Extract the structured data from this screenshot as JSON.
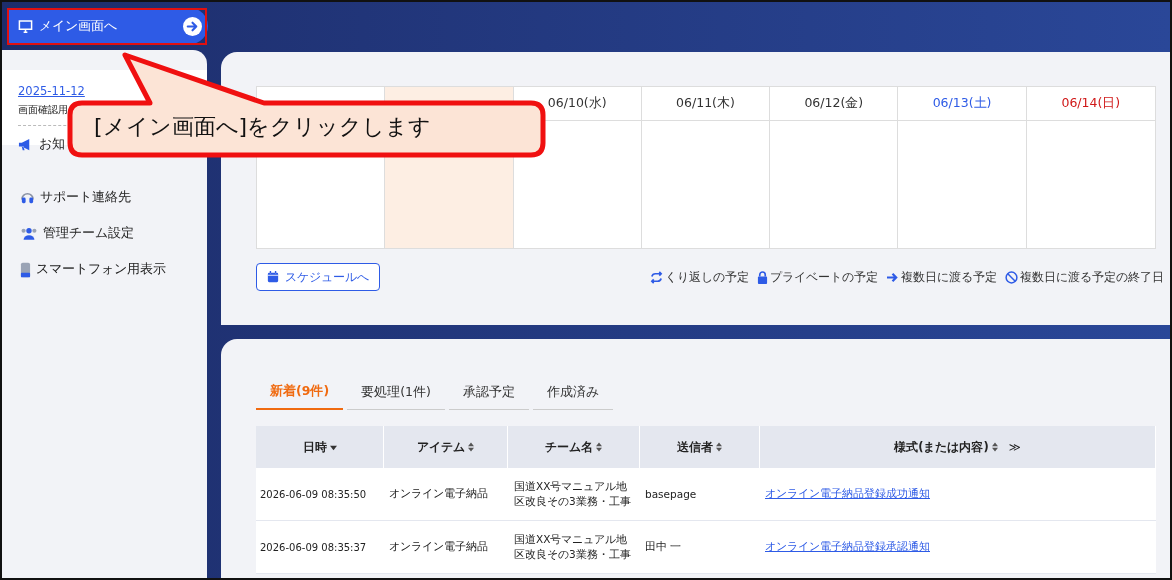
{
  "top_bar": {
    "main_button": "メイン画面へ"
  },
  "sidebar": {
    "date_link": "2025-11-12",
    "note": "画面確認用",
    "notice": "お知",
    "items": [
      {
        "label": "サポート連絡先"
      },
      {
        "label": "管理チーム設定"
      },
      {
        "label": "スマートフォン用表示"
      }
    ]
  },
  "calendar": {
    "days": [
      {
        "kind": "weekday",
        "today": false
      },
      {
        "kind": "weekday",
        "today": true
      },
      {
        "label": "06/10(水)",
        "kind": "weekday",
        "today": false
      },
      {
        "label": "06/11(木)",
        "kind": "weekday",
        "today": false
      },
      {
        "label": "06/12(金)",
        "kind": "weekday",
        "today": false
      },
      {
        "label": "06/13(土)",
        "kind": "saturday",
        "today": false
      },
      {
        "label": "06/14(日)",
        "kind": "sunday",
        "today": false
      }
    ],
    "schedule_button": "スケジュールへ",
    "legend": [
      {
        "label": "くり返しの予定"
      },
      {
        "label": "プライベートの予定"
      },
      {
        "label": "複数日に渡る予定"
      },
      {
        "label": "複数日に渡る予定の終了日"
      }
    ]
  },
  "inbox": {
    "tabs": [
      {
        "label": "新着(9件)",
        "selected": true
      },
      {
        "label": "要処理(1件)",
        "selected": false
      },
      {
        "label": "承認予定",
        "selected": false
      },
      {
        "label": "作成済み",
        "selected": false
      }
    ],
    "columns": [
      {
        "label": "日時"
      },
      {
        "label": "アイテム"
      },
      {
        "label": "チーム名"
      },
      {
        "label": "送信者"
      },
      {
        "label": "様式(または内容)",
        "expand": "≫"
      }
    ],
    "rows": [
      {
        "datetime": "2026-06-09 08:35:50",
        "item": "オンライン電子納品",
        "team": "国道XX号マニュアル地区改良その3業務・工事",
        "sender": "basepage",
        "form": "オンライン電子納品登録成功通知"
      },
      {
        "datetime": "2026-06-09 08:35:37",
        "item": "オンライン電子納品",
        "team": "国道XX号マニュアル地区改良その3業務・工事",
        "sender": "田中 一",
        "form": "オンライン電子納品登録承認通知"
      }
    ]
  },
  "callout": {
    "text": "[メイン画面へ]をクリックします"
  }
}
